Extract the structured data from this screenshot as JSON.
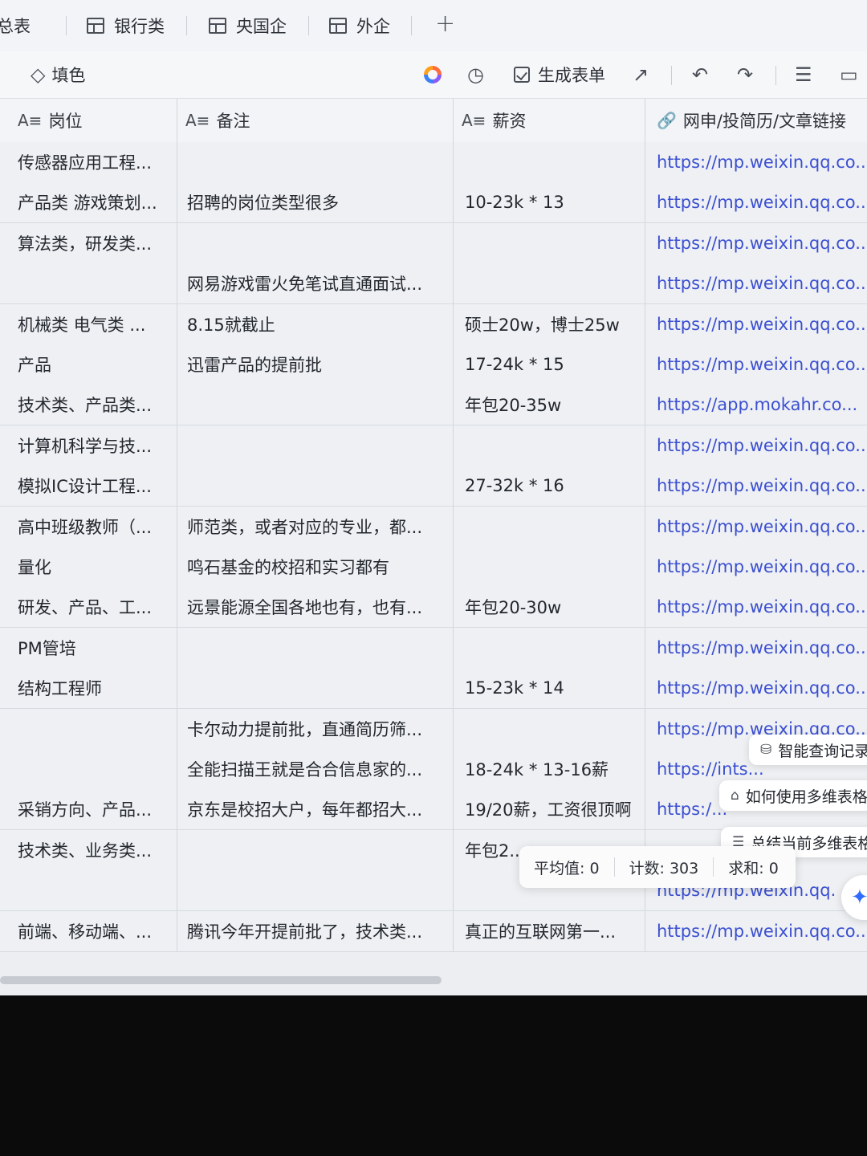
{
  "tabs": [
    {
      "label": "总表"
    },
    {
      "label": "银行类"
    },
    {
      "label": "央国企"
    },
    {
      "label": "外企"
    }
  ],
  "tab_add": "+",
  "toolbar": {
    "fill_label": "填色",
    "generate_form_label": "生成表单"
  },
  "columns": [
    {
      "label": "岗位",
      "icon": "A≡"
    },
    {
      "label": "备注",
      "icon": "A≡"
    },
    {
      "label": "薪资",
      "icon": "A≡"
    },
    {
      "label": "网申/投简历/文章链接",
      "icon": "🔗"
    }
  ],
  "rows": [
    {
      "position": "传感器应用工程...",
      "note": "",
      "salary": "",
      "link": "https://mp.weixin.qq.co..."
    },
    {
      "position": "产品类 游戏策划...",
      "note": "招聘的岗位类型很多",
      "salary": "10-23k * 13",
      "link": "https://mp.weixin.qq.co..."
    },
    {
      "position": "算法类，研发类...",
      "note": "",
      "salary": "",
      "link": "https://mp.weixin.qq.co..."
    },
    {
      "position": "",
      "note": "网易游戏雷火免笔试直通面试...",
      "salary": "",
      "link": "https://mp.weixin.qq.co..."
    },
    {
      "position": "机械类 电气类 ...",
      "note": "8.15就截止",
      "salary": "硕士20w，博士25w",
      "link": "https://mp.weixin.qq.co..."
    },
    {
      "position": "产品",
      "note": "迅雷产品的提前批",
      "salary": "17-24k * 15",
      "link": "https://mp.weixin.qq.co..."
    },
    {
      "position": "技术类、产品类...",
      "note": "",
      "salary": "年包20-35w",
      "link": "https://app.mokahr.co..."
    },
    {
      "position": "计算机科学与技...",
      "note": "",
      "salary": "",
      "link": "https://mp.weixin.qq.co..."
    },
    {
      "position": "模拟IC设计工程...",
      "note": "",
      "salary": "27-32k * 16",
      "link": "https://mp.weixin.qq.co..."
    },
    {
      "position": "高中班级教师（...",
      "note": "师范类，或者对应的专业，都...",
      "salary": "",
      "link": "https://mp.weixin.qq.co..."
    },
    {
      "position": "量化",
      "note": "鸣石基金的校招和实习都有",
      "salary": "",
      "link": "https://mp.weixin.qq.co..."
    },
    {
      "position": "研发、产品、工...",
      "note": "远景能源全国各地也有，也有...",
      "salary": "年包20-30w",
      "link": "https://mp.weixin.qq.co..."
    },
    {
      "position": "PM管培",
      "note": "",
      "salary": "",
      "link": "https://mp.weixin.qq.co..."
    },
    {
      "position": "结构工程师",
      "note": "",
      "salary": "15-23k * 14",
      "link": "https://mp.weixin.qq.co..."
    },
    {
      "position": "",
      "note": "卡尔动力提前批，直通简历筛...",
      "salary": "",
      "link": "https://mp.weixin.qq.co..."
    },
    {
      "position": "",
      "note": "全能扫描王就是合合信息家的...",
      "salary": "18-24k * 13-16薪",
      "link": "https://ints..."
    },
    {
      "position": "采销方向、产品...",
      "note": "京东是校招大户，每年都招大...",
      "salary": "19/20薪，工资很顶啊",
      "link": "https:/..."
    },
    {
      "position": "技术类、业务类...",
      "note": "",
      "salary": "年包2...",
      "link": ""
    },
    {
      "position": "",
      "note": "",
      "salary": "",
      "link": "https://mp.weixin.qq."
    },
    {
      "position": "前端、移动端、...",
      "note": "腾讯今年开提前批了，技术类...",
      "salary": "真正的互联网第一...",
      "link": "https://mp.weixin.qq.co..."
    }
  ],
  "popups": {
    "smart_query": "智能查询记录",
    "how_to_use": "如何使用多维表格",
    "summarize": "总结当前多维表格"
  },
  "stats": {
    "average": "平均值: 0",
    "count": "计数: 303",
    "sum": "求和: 0"
  }
}
